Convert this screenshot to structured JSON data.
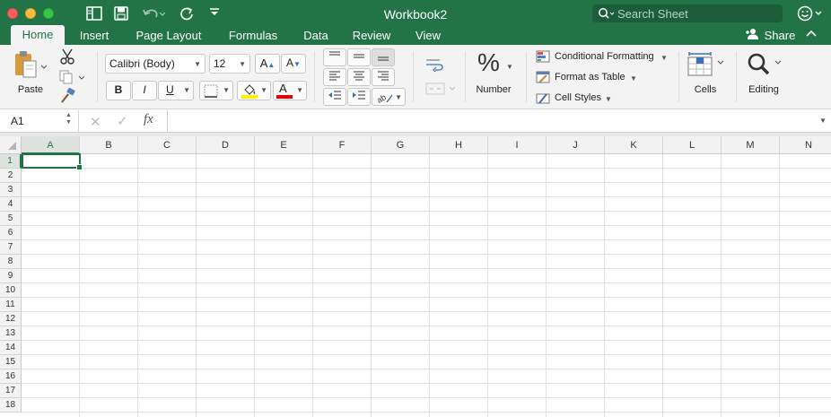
{
  "window": {
    "title": "Workbook2",
    "search_placeholder": "Search Sheet",
    "accent_color": "#227447"
  },
  "tabs": [
    {
      "label": "Home",
      "active": true
    },
    {
      "label": "Insert"
    },
    {
      "label": "Page Layout"
    },
    {
      "label": "Formulas"
    },
    {
      "label": "Data"
    },
    {
      "label": "Review"
    },
    {
      "label": "View"
    }
  ],
  "share_label": "Share",
  "ribbon": {
    "paste_label": "Paste",
    "font_name": "Calibri (Body)",
    "font_size": "12",
    "bold": "B",
    "italic": "I",
    "underline": "U",
    "font_color_glyph": "A",
    "grow_font": "A",
    "shrink_font": "A",
    "number_symbol": "%",
    "number_label": "Number",
    "conditional_formatting": "Conditional Formatting",
    "format_as_table": "Format as Table",
    "cell_styles": "Cell Styles",
    "cells_label": "Cells",
    "editing_label": "Editing"
  },
  "formula_bar": {
    "name_box": "A1",
    "fx": "fx",
    "content": ""
  },
  "grid": {
    "columns": [
      "A",
      "B",
      "C",
      "D",
      "E",
      "F",
      "G",
      "H",
      "I",
      "J",
      "K",
      "L",
      "M",
      "N"
    ],
    "rows": [
      "1",
      "2",
      "3",
      "4",
      "5",
      "6",
      "7",
      "8",
      "9",
      "10",
      "11",
      "12",
      "13",
      "14",
      "15",
      "16",
      "17",
      "18"
    ],
    "selected_cell": "A1"
  }
}
